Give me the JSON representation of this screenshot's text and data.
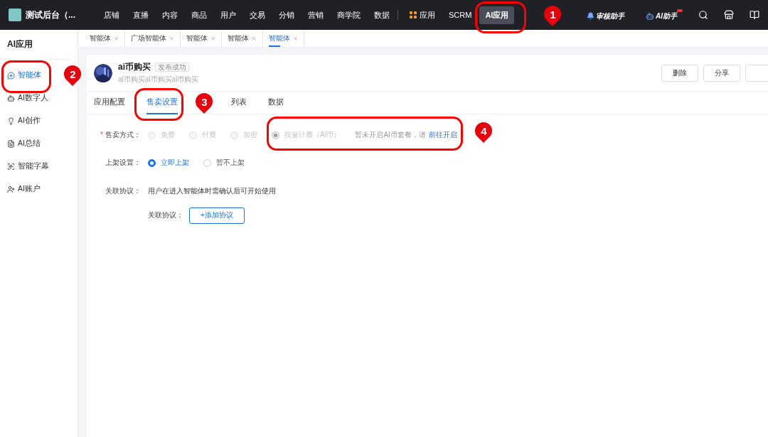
{
  "top_nav": {
    "logo_text": "测试后台（...",
    "items": [
      {
        "label": "店铺",
        "selected": false,
        "kind": "text"
      },
      {
        "label": "直播",
        "selected": false,
        "kind": "text"
      },
      {
        "label": "内容",
        "selected": false,
        "kind": "text"
      },
      {
        "label": "商品",
        "selected": false,
        "kind": "text"
      },
      {
        "label": "用户",
        "selected": false,
        "kind": "text"
      },
      {
        "label": "交易",
        "selected": false,
        "kind": "text"
      },
      {
        "label": "分销",
        "selected": false,
        "kind": "text"
      },
      {
        "label": "营销",
        "selected": false,
        "kind": "text"
      },
      {
        "label": "商学院",
        "selected": false,
        "kind": "text"
      },
      {
        "label": "数据",
        "selected": false,
        "kind": "text"
      },
      {
        "label": "应用",
        "selected": false,
        "kind": "apps"
      },
      {
        "label": "SCRM",
        "selected": false,
        "kind": "text"
      },
      {
        "label": "AI应用",
        "selected": true,
        "kind": "text"
      }
    ],
    "assistants": [
      {
        "label": "审核助手",
        "kind": "bell",
        "badge": false
      },
      {
        "label": "AI助手",
        "kind": "robot",
        "badge": true
      }
    ]
  },
  "sidebar": {
    "title": "AI应用",
    "items": [
      {
        "label": "智能体",
        "selected": true
      },
      {
        "label": "AI数字人",
        "selected": false
      },
      {
        "label": "AI创作",
        "selected": false
      },
      {
        "label": "AI总结",
        "selected": false
      },
      {
        "label": "智能字幕",
        "selected": false
      },
      {
        "label": "AI账户",
        "selected": false
      }
    ]
  },
  "page_tabs": [
    {
      "label": "智能体",
      "selected": false
    },
    {
      "label": "广场智能体",
      "selected": false
    },
    {
      "label": "智能体",
      "selected": false
    },
    {
      "label": "智能体",
      "selected": false
    },
    {
      "label": "智能体",
      "selected": true
    }
  ],
  "app": {
    "name": "ai币购买",
    "status": "发布成功",
    "description": "ai币购买ai币购买ai币购买",
    "actions": [
      "删除",
      "分享"
    ]
  },
  "tabs": [
    {
      "label": "应用配置",
      "selected": false
    },
    {
      "label": "售卖设置",
      "selected": true
    },
    {
      "label": "列表",
      "selected": false
    },
    {
      "label": "数据",
      "selected": false
    }
  ],
  "form": {
    "sale_mode": {
      "required_mark": "*",
      "label": "售卖方式：",
      "options": [
        {
          "label": "免费",
          "selected": false,
          "disabled": true
        },
        {
          "label": "付费",
          "selected": false,
          "disabled": true
        },
        {
          "label": "加密",
          "selected": false,
          "disabled": true
        },
        {
          "label": "按量计费（AI币）",
          "selected": true,
          "disabled": true
        }
      ],
      "hint": "暂未开启AI币套餐，请",
      "link": "前往开启"
    },
    "listing": {
      "label": "上架设置：",
      "options": [
        {
          "label": "立即上架",
          "selected": true,
          "disabled": false
        },
        {
          "label": "暂不上架",
          "selected": false,
          "disabled": false
        }
      ]
    },
    "agreement": {
      "label": "关联协议：",
      "text": "用户在进入智能体时需确认后可开始使用",
      "sub_label": "关联协议：",
      "button": "+添加协议"
    }
  },
  "annotations": [
    {
      "number": "1"
    },
    {
      "number": "2"
    },
    {
      "number": "3"
    },
    {
      "number": "4"
    }
  ]
}
